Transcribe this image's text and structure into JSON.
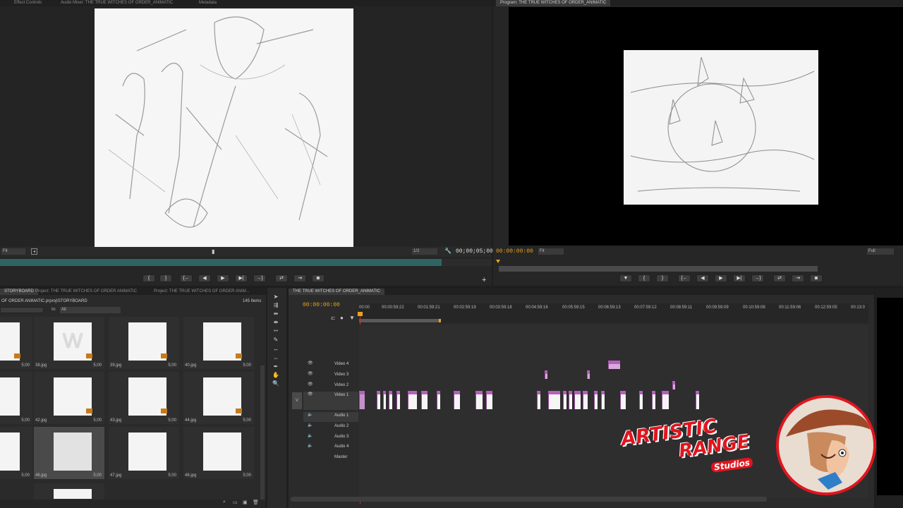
{
  "source_monitor": {
    "tabs": [
      "Effect Controls",
      "Audio Mixer: THE TRUE WITCHES OF ORDER_ANIMATIC",
      "Metadata"
    ],
    "fit": "Fit",
    "resolution": "1/2",
    "timecode": "00;00;05;00"
  },
  "program_monitor": {
    "tab": "Program: THE TRUE WITCHES OF ORDER_ANIMATIC",
    "timecode": "00:00:00:00",
    "fit": "Fit",
    "quality": "Full"
  },
  "project": {
    "tabs": [
      "STORYBOARD",
      "Project: THE TRUE WITCHES OF ORDER ANIMATIC",
      "Project: THE TRUE WITCHES OF ORDER ANIM..."
    ],
    "path": "OF ORDER ANIMATIC.prproj\\STORYBOARD",
    "items_count": "145 Items",
    "in_label": "In:",
    "in_value": "All",
    "thumbs": [
      {
        "name": "",
        "dur": "5;00"
      },
      {
        "name": "38.jpg",
        "dur": "5;00"
      },
      {
        "name": "39.jpg",
        "dur": "5;00"
      },
      {
        "name": "40.jpg",
        "dur": "5;00"
      },
      {
        "name": "",
        "dur": "5;00"
      },
      {
        "name": "42.jpg",
        "dur": "5;00"
      },
      {
        "name": "43.jpg",
        "dur": "5;00"
      },
      {
        "name": "44.jpg",
        "dur": "5;00"
      },
      {
        "name": "",
        "dur": "5;00"
      },
      {
        "name": "46.jpg",
        "dur": "5;00"
      },
      {
        "name": "47.jpg",
        "dur": "5;00"
      },
      {
        "name": "48.jpg",
        "dur": "5;00"
      }
    ]
  },
  "timeline": {
    "tab": "THE TRUE WITCHES OF ORDER_ANIMATIC",
    "timecode": "00:00:00:00",
    "ruler": [
      "00:00",
      "00:00:59:22",
      "00:01:59:21",
      "00:02:59:19",
      "00:03:59:18",
      "00:04:59:16",
      "00:05:59:15",
      "00:06:59:13",
      "00:07:59:12",
      "00:08:59:11",
      "00:09:59:09",
      "00:10:59:08",
      "00:11:59:06",
      "00:12:59:05",
      "00:13:0"
    ],
    "tracks": [
      "Video 4",
      "Video 3",
      "Video 2",
      "Video 1",
      "Audio 1",
      "Audio 2",
      "Audio 3",
      "Audio 4",
      "Master"
    ],
    "v_label": "V"
  },
  "logo": {
    "line1": "ARTISTIC",
    "line2": "RANGE",
    "line3": "Studios"
  },
  "colors": {
    "accent": "#e8a31c",
    "clip": "#b65fbf",
    "logo_red": "#e0151f"
  }
}
